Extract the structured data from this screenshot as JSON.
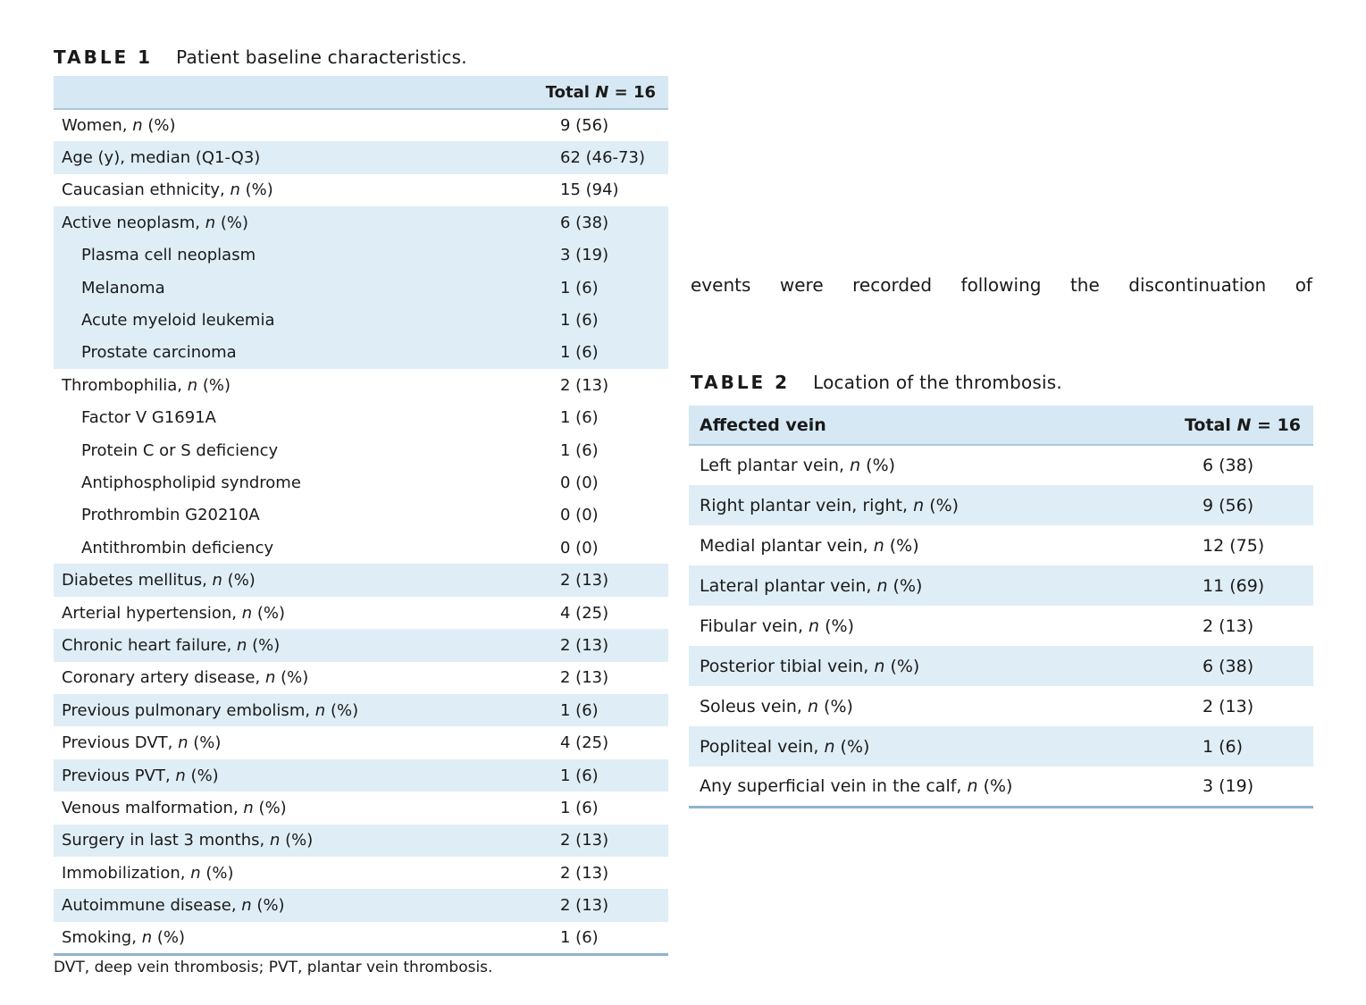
{
  "table1": {
    "label": "TABLE 1",
    "title": "Patient baseline characteristics.",
    "header": {
      "col1": "",
      "col2_prefix": "Total ",
      "col2_n": "N",
      "col2_suffix": " = 16"
    },
    "rows": [
      {
        "pre": "Women, ",
        "it": "n",
        "post": " (%)",
        "val": "9 (56)",
        "indent": false,
        "shade": false
      },
      {
        "pre": "Age (y), median (Q1-Q3)",
        "it": "",
        "post": "",
        "val": "62 (46-73)",
        "indent": false,
        "shade": true
      },
      {
        "pre": "Caucasian ethnicity, ",
        "it": "n",
        "post": " (%)",
        "val": "15 (94)",
        "indent": false,
        "shade": false
      },
      {
        "pre": "Active neoplasm, ",
        "it": "n",
        "post": " (%)",
        "val": "6 (38)",
        "indent": false,
        "shade": true
      },
      {
        "pre": "Plasma cell neoplasm",
        "it": "",
        "post": "",
        "val": "3 (19)",
        "indent": true,
        "shade": true
      },
      {
        "pre": "Melanoma",
        "it": "",
        "post": "",
        "val": "1 (6)",
        "indent": true,
        "shade": true
      },
      {
        "pre": "Acute myeloid leukemia",
        "it": "",
        "post": "",
        "val": "1 (6)",
        "indent": true,
        "shade": true
      },
      {
        "pre": "Prostate carcinoma",
        "it": "",
        "post": "",
        "val": "1 (6)",
        "indent": true,
        "shade": true
      },
      {
        "pre": "Thrombophilia, ",
        "it": "n",
        "post": " (%)",
        "val": "2 (13)",
        "indent": false,
        "shade": false
      },
      {
        "pre": "Factor V G1691A",
        "it": "",
        "post": "",
        "val": "1 (6)",
        "indent": true,
        "shade": false
      },
      {
        "pre": "Protein C or S deficiency",
        "it": "",
        "post": "",
        "val": "1 (6)",
        "indent": true,
        "shade": false
      },
      {
        "pre": "Antiphospholipid syndrome",
        "it": "",
        "post": "",
        "val": "0 (0)",
        "indent": true,
        "shade": false
      },
      {
        "pre": "Prothrombin G20210A",
        "it": "",
        "post": "",
        "val": "0 (0)",
        "indent": true,
        "shade": false
      },
      {
        "pre": "Antithrombin deficiency",
        "it": "",
        "post": "",
        "val": "0 (0)",
        "indent": true,
        "shade": false
      },
      {
        "pre": "Diabetes mellitus, ",
        "it": "n",
        "post": " (%)",
        "val": "2 (13)",
        "indent": false,
        "shade": true
      },
      {
        "pre": "Arterial hypertension, ",
        "it": "n",
        "post": " (%)",
        "val": "4 (25)",
        "indent": false,
        "shade": false
      },
      {
        "pre": "Chronic heart failure, ",
        "it": "n",
        "post": " (%)",
        "val": "2 (13)",
        "indent": false,
        "shade": true
      },
      {
        "pre": "Coronary artery disease, ",
        "it": "n",
        "post": " (%)",
        "val": "2 (13)",
        "indent": false,
        "shade": false
      },
      {
        "pre": "Previous pulmonary embolism, ",
        "it": "n",
        "post": " (%)",
        "val": "1 (6)",
        "indent": false,
        "shade": true
      },
      {
        "pre": "Previous DVT, ",
        "it": "n",
        "post": " (%)",
        "val": "4 (25)",
        "indent": false,
        "shade": false
      },
      {
        "pre": "Previous PVT, ",
        "it": "n",
        "post": " (%)",
        "val": "1 (6)",
        "indent": false,
        "shade": true
      },
      {
        "pre": "Venous malformation, ",
        "it": "n",
        "post": " (%)",
        "val": "1 (6)",
        "indent": false,
        "shade": false
      },
      {
        "pre": "Surgery in last 3 months, ",
        "it": "n",
        "post": " (%)",
        "val": "2 (13)",
        "indent": false,
        "shade": true
      },
      {
        "pre": "Immobilization, ",
        "it": "n",
        "post": " (%)",
        "val": "2 (13)",
        "indent": false,
        "shade": false
      },
      {
        "pre": "Autoimmune disease, ",
        "it": "n",
        "post": " (%)",
        "val": "2 (13)",
        "indent": false,
        "shade": true
      },
      {
        "pre": "Smoking, ",
        "it": "n",
        "post": " (%)",
        "val": "1 (6)",
        "indent": false,
        "shade": false
      }
    ],
    "footnote": "DVT, deep vein thrombosis; PVT, plantar vein thrombosis."
  },
  "body_text": [
    "events",
    "were",
    "recorded",
    "following",
    "the",
    "discontinuation",
    "of"
  ],
  "table2": {
    "label": "TABLE 2",
    "title": "Location of the thrombosis.",
    "header": {
      "col1": "Affected vein",
      "col2_prefix": "Total ",
      "col2_n": "N",
      "col2_suffix": " = 16"
    },
    "rows": [
      {
        "pre": "Left plantar vein, ",
        "it": "n",
        "post": " (%)",
        "val": "6 (38)",
        "shade": false
      },
      {
        "pre": "Right plantar vein, right, ",
        "it": "n",
        "post": " (%)",
        "val": "9 (56)",
        "shade": true
      },
      {
        "pre": "Medial plantar vein, ",
        "it": "n",
        "post": " (%)",
        "val": "12 (75)",
        "shade": false
      },
      {
        "pre": "Lateral plantar vein, ",
        "it": "n",
        "post": " (%)",
        "val": "11 (69)",
        "shade": true
      },
      {
        "pre": "Fibular vein, ",
        "it": "n",
        "post": " (%)",
        "val": "2 (13)",
        "shade": false
      },
      {
        "pre": "Posterior tibial vein, ",
        "it": "n",
        "post": " (%)",
        "val": "6 (38)",
        "shade": true
      },
      {
        "pre": "Soleus vein, ",
        "it": "n",
        "post": " (%)",
        "val": "2 (13)",
        "shade": false
      },
      {
        "pre": "Popliteal vein, ",
        "it": "n",
        "post": " (%)",
        "val": "1 (6)",
        "shade": true
      },
      {
        "pre": "Any superficial vein in the calf, ",
        "it": "n",
        "post": " (%)",
        "val": "3 (19)",
        "shade": false
      }
    ]
  }
}
